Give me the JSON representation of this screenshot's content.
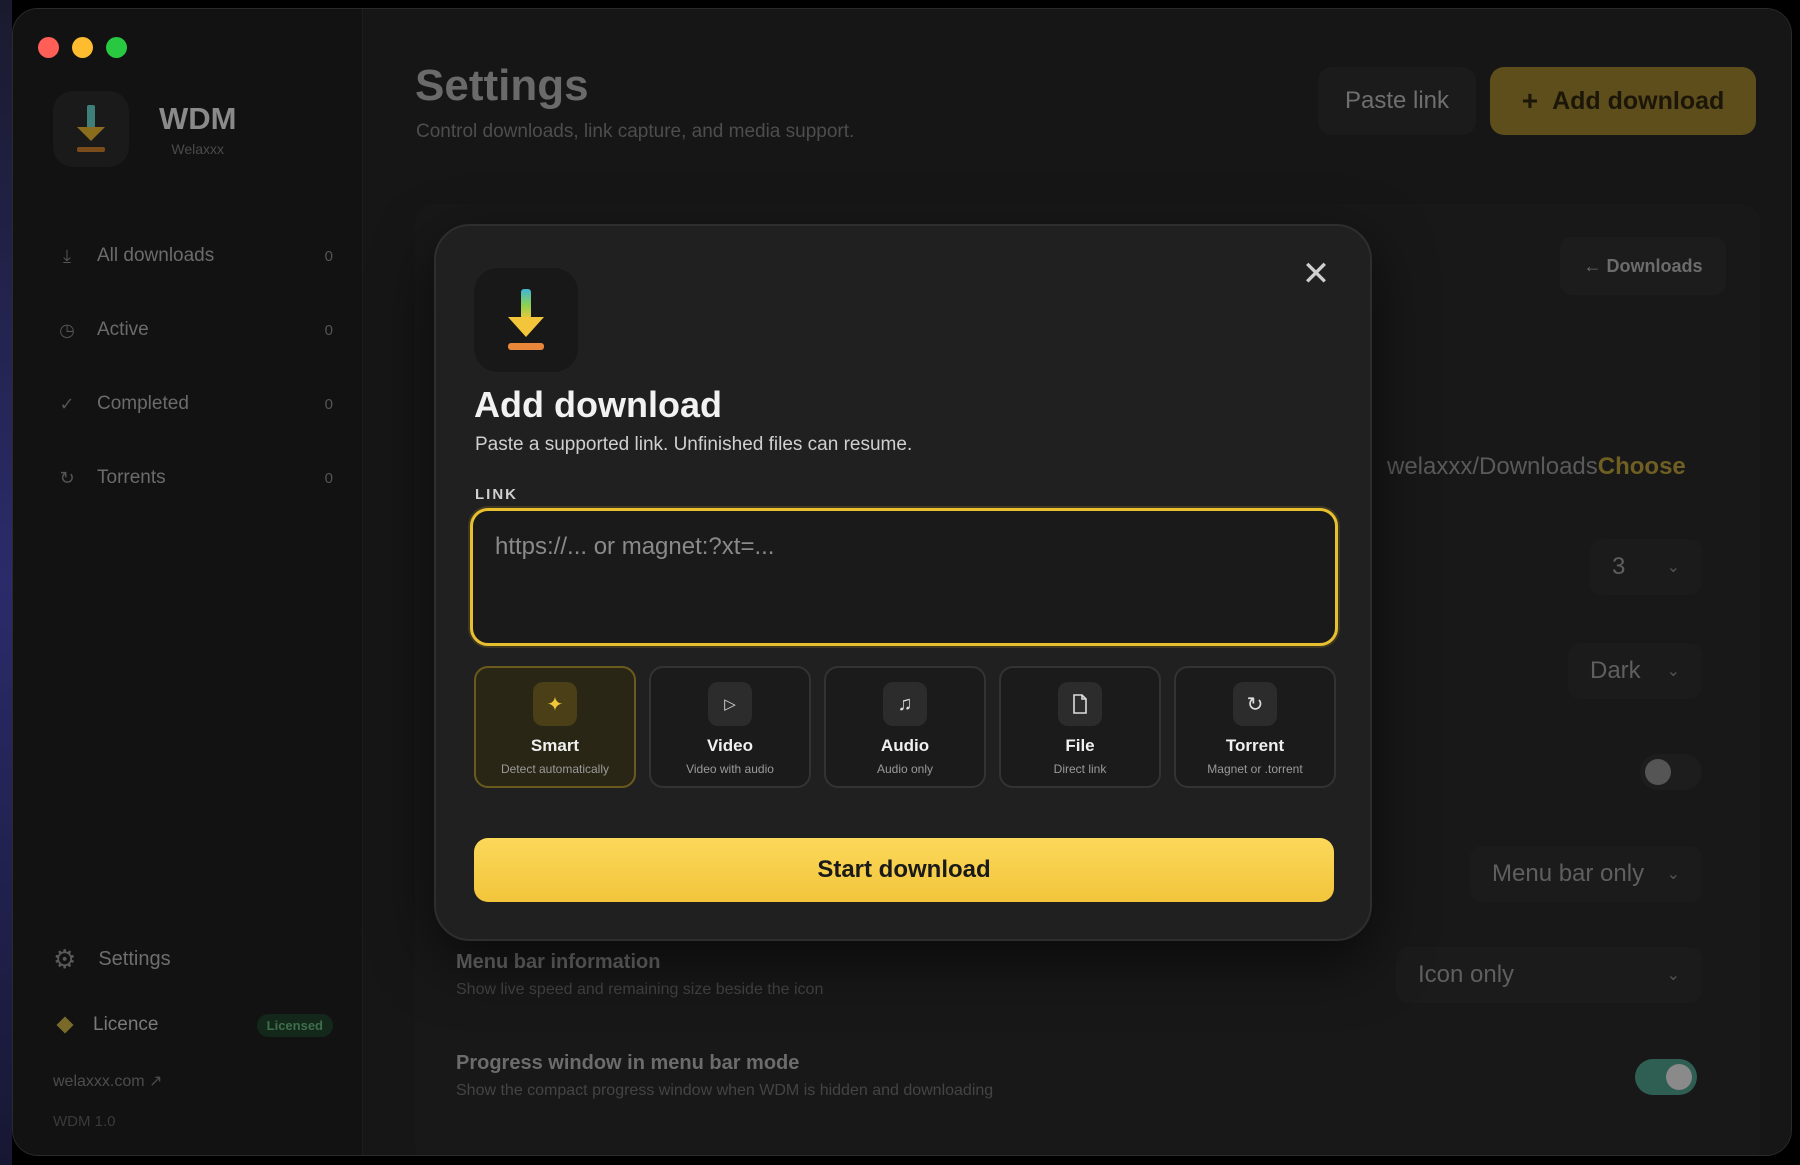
{
  "app": {
    "name": "WDM",
    "subtitle": "Welaxxx",
    "site_link": "welaxxx.com ↗",
    "version": "WDM 1.0"
  },
  "sidebar": {
    "items": [
      {
        "label": "All downloads",
        "count": "0",
        "icon": "download-icon"
      },
      {
        "label": "Active",
        "count": "0",
        "icon": "clock-icon"
      },
      {
        "label": "Completed",
        "count": "0",
        "icon": "check-icon"
      },
      {
        "label": "Torrents",
        "count": "0",
        "icon": "refresh-icon"
      }
    ],
    "settings_label": "Settings",
    "licence_label": "Licence",
    "licence_badge": "Licensed"
  },
  "header": {
    "title": "Settings",
    "subtitle": "Control downloads, link capture, and media support.",
    "paste_link": "Paste link",
    "add_download": "Add download"
  },
  "settings_bg": {
    "downloads_button": "← Downloads",
    "folder_path": "welaxxx/Downloads",
    "choose": "Choose",
    "concurrent_value": "3",
    "theme_value": "Dark",
    "dock_mode_value": "Menu bar only",
    "menu_bar_info_title": "Menu bar information",
    "menu_bar_info_desc": "Show live speed and remaining size beside the icon",
    "menu_bar_info_value": "Icon only",
    "progress_window_title": "Progress window in menu bar mode",
    "progress_window_desc": "Show the compact progress window when WDM is hidden and downloading"
  },
  "modal": {
    "title": "Add download",
    "subtitle": "Paste a supported link. Unfinished files can resume.",
    "link_label": "LINK",
    "link_value": "",
    "link_placeholder": "https://... or magnet:?xt=...",
    "modes": [
      {
        "label": "Smart",
        "desc": "Detect automatically",
        "icon": "sparkle-icon",
        "active": true
      },
      {
        "label": "Video",
        "desc": "Video with audio",
        "icon": "play-icon",
        "active": false
      },
      {
        "label": "Audio",
        "desc": "Audio only",
        "icon": "music-note-icon",
        "active": false
      },
      {
        "label": "File",
        "desc": "Direct link",
        "icon": "file-icon",
        "active": false
      },
      {
        "label": "Torrent",
        "desc": "Magnet or .torrent",
        "icon": "refresh-icon",
        "active": false
      }
    ],
    "start_button": "Start download"
  },
  "colors": {
    "accent": "#f2c53b",
    "accent_border": "#e8bf2e",
    "toggle_on": "#2f5e52"
  }
}
